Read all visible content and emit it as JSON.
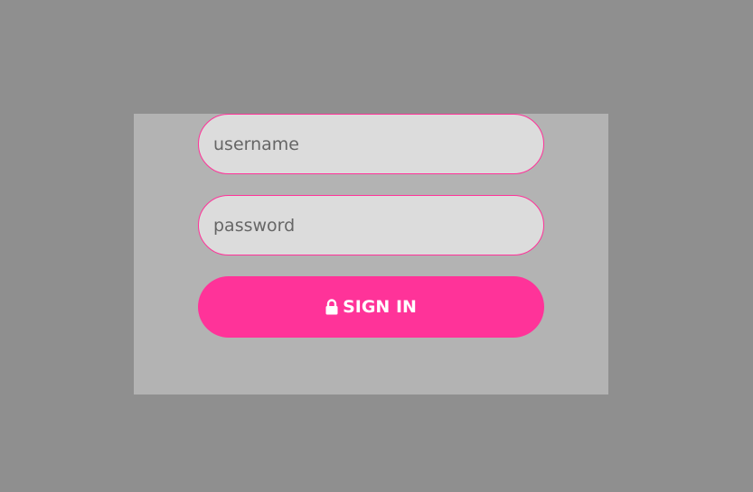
{
  "login_form": {
    "username": {
      "value": "",
      "placeholder": "username"
    },
    "password": {
      "value": "",
      "placeholder": "password"
    },
    "signin_button": {
      "label": "SIGN IN",
      "icon": "lock-icon"
    }
  },
  "colors": {
    "page_background": "#8f8f8f",
    "panel_background": "#b3b3b3",
    "field_background": "#dcdcdc",
    "accent": "#ff3399",
    "button_text": "#ffffff"
  }
}
